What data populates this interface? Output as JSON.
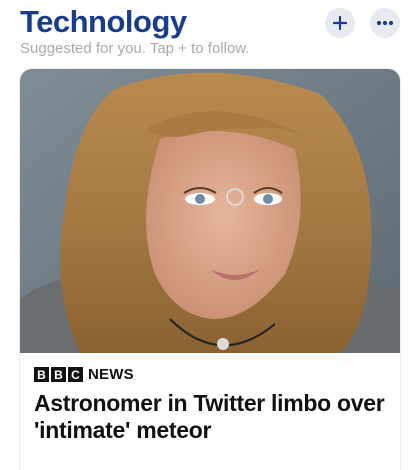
{
  "header": {
    "title": "Technology",
    "subtitle": "Suggested for you. Tap + to follow.",
    "add_icon": "plus-icon",
    "more_icon": "more-horizontal-icon"
  },
  "colors": {
    "title": "#1a3c8f",
    "subtitle": "#a9aab0",
    "icon_button_bg": "#e8eaf1",
    "icon": "#1a3c8f"
  },
  "article": {
    "source": {
      "logo_letters": [
        "B",
        "B",
        "C"
      ],
      "name": "NEWS"
    },
    "headline": "Astronomer in Twitter limbo over 'intimate' meteor"
  }
}
